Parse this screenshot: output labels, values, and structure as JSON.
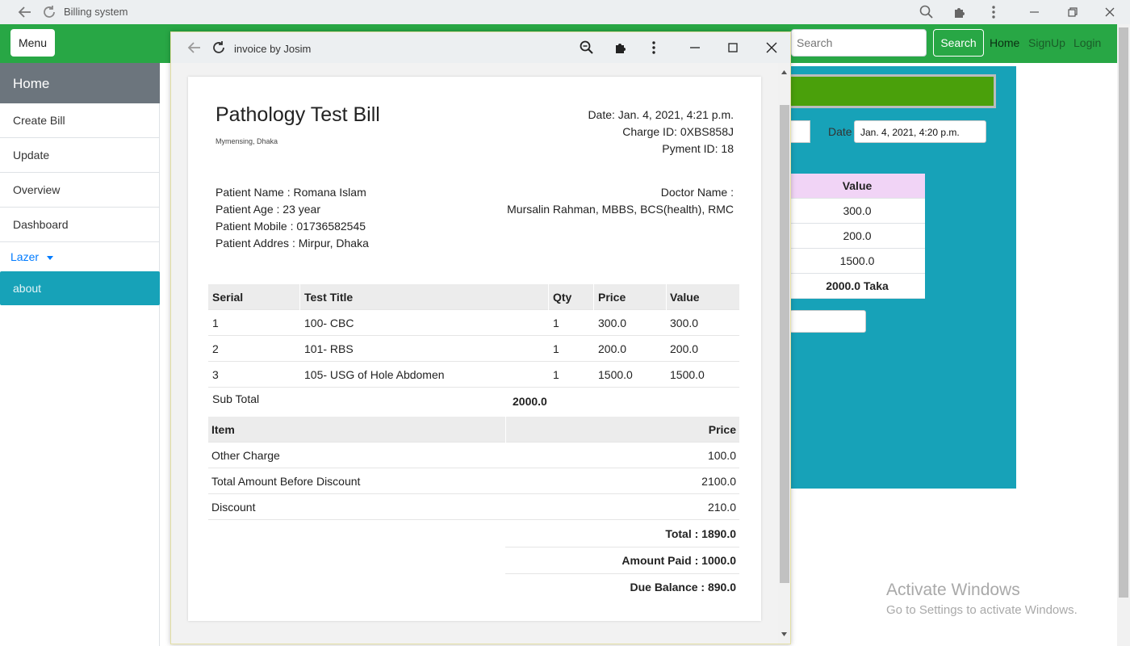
{
  "outer_browser": {
    "title": "Billing system"
  },
  "navbar": {
    "menu_label": "Menu",
    "search_placeholder": "Search",
    "search_button": "Search",
    "links": [
      "Home",
      "SignUp",
      "Login"
    ]
  },
  "sidebar": {
    "home": "Home",
    "items": [
      "Create Bill",
      "Update",
      "Overview",
      "Dashboard"
    ],
    "dropdown": "Lazer",
    "about": "about"
  },
  "background_form": {
    "date_label": "Date",
    "date_value": "Jan. 4, 2021, 4:20 p.m.",
    "table_header": "Value",
    "values": [
      "300.0",
      "200.0",
      "1500.0"
    ],
    "total": "2000.0 Taka"
  },
  "watermark": {
    "title": "Activate Windows",
    "subtitle": "Go to Settings to activate Windows."
  },
  "popup": {
    "title": "invoice by Josim"
  },
  "invoice": {
    "title": "Pathology Test Bill",
    "location": "Mymensing, Dhaka",
    "date": "Date: Jan. 4, 2021, 4:21 p.m.",
    "charge_id": "Charge ID: 0XBS858J",
    "payment_id": "Pyment ID: 18",
    "patient_name": "Patient Name : Romana Islam",
    "patient_age": "Patient Age : 23 year",
    "patient_mobile": "Patient Mobile : 01736582545",
    "patient_address": "Patient Addres : Mirpur, Dhaka",
    "doctor_label": "Doctor Name :",
    "doctor_name": "Mursalin Rahman, MBBS, BCS(health), RMC",
    "tests_table": {
      "headers": [
        "Serial",
        "Test Title",
        "Qty",
        "Price",
        "Value"
      ],
      "rows": [
        [
          "1",
          "100- CBC",
          "1",
          "300.0",
          "300.0"
        ],
        [
          "2",
          "101- RBS",
          "1",
          "200.0",
          "200.0"
        ],
        [
          "3",
          "105- USG of Hole Abdomen",
          "1",
          "1500.0",
          "1500.0"
        ]
      ],
      "subtotal_label": "Sub Total",
      "subtotal_value": "2000.0"
    },
    "charges_table": {
      "headers": [
        "Item",
        "Price"
      ],
      "rows": [
        [
          "Other Charge",
          "100.0"
        ],
        [
          "Total Amount Before Discount",
          "2100.0"
        ],
        [
          "Discount",
          "210.0"
        ]
      ],
      "total": "Total : 1890.0",
      "amount_paid": "Amount Paid : 1000.0",
      "due_balance": "Due Balance : 890.0"
    }
  }
}
